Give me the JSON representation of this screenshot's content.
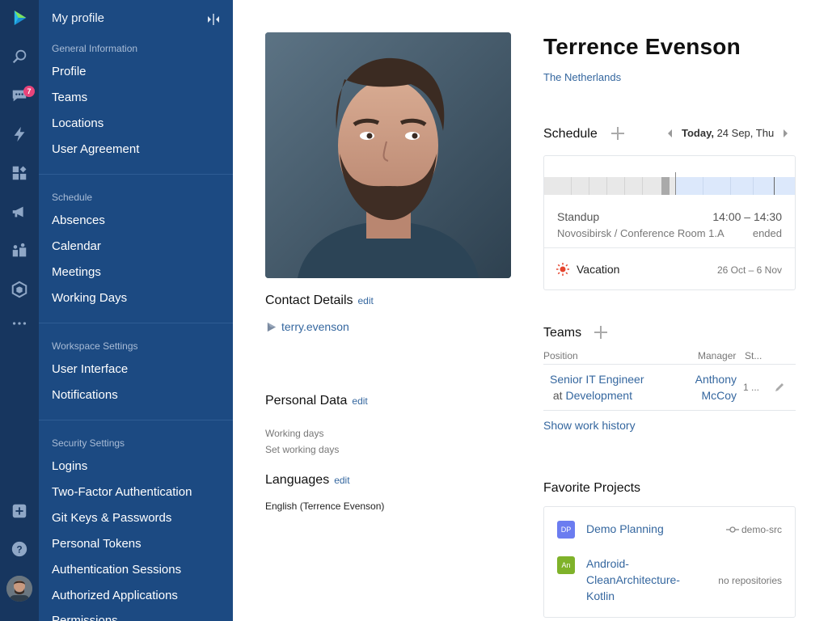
{
  "rail": {
    "icons": [
      "app-logo-icon",
      "search-icon",
      "chat-icon",
      "lightning-icon",
      "dashboard-icon",
      "megaphone-icon",
      "team-icon",
      "package-icon",
      "more-icon",
      "add-icon",
      "help-icon"
    ],
    "chat_badge": "7"
  },
  "sidebar": {
    "title": "My profile",
    "sections": [
      {
        "label": "General Information",
        "items": [
          "Profile",
          "Teams",
          "Locations",
          "User Agreement"
        ]
      },
      {
        "label": "Schedule",
        "items": [
          "Absences",
          "Calendar",
          "Meetings",
          "Working Days"
        ]
      },
      {
        "label": "Workspace Settings",
        "items": [
          "User Interface",
          "Notifications"
        ]
      },
      {
        "label": "Security Settings",
        "items": [
          "Logins",
          "Two-Factor Authentication",
          "Git Keys & Passwords",
          "Personal Tokens",
          "Authentication Sessions",
          "Authorized Applications",
          "Permissions"
        ]
      }
    ]
  },
  "profile": {
    "name": "Terrence Evenson",
    "country": "The Netherlands"
  },
  "contact": {
    "heading": "Contact Details",
    "edit": "edit",
    "username": "terry.evenson"
  },
  "personal": {
    "heading": "Personal Data",
    "edit": "edit",
    "working_days_label": "Working days",
    "working_days_link": "Set working days"
  },
  "languages": {
    "heading": "Languages",
    "edit": "edit",
    "value": "English (Terrence Evenson)"
  },
  "schedule": {
    "heading": "Schedule",
    "date_bold": "Today,",
    "date_rest": " 24 Sep, Thu",
    "event": {
      "title": "Standup",
      "time": "14:00 – 14:30",
      "location": "Novosibirsk / Conference Room 1.A",
      "status": "ended"
    },
    "vacation": {
      "label": "Vacation",
      "dates": "26 Oct – 6 Nov"
    }
  },
  "teams": {
    "heading": "Teams",
    "columns": {
      "position": "Position",
      "manager": "Manager",
      "status": "St..."
    },
    "row": {
      "role": "Senior IT Engineer",
      "at": " at ",
      "team": "Development",
      "manager": "Anthony McCoy",
      "status": "1 ..."
    },
    "history_link": "Show work history"
  },
  "projects": {
    "heading": "Favorite Projects",
    "items": [
      {
        "initials": "DP",
        "name": "Demo Planning",
        "repo": "demo-src",
        "color": "#6b7cf0"
      },
      {
        "initials": "An",
        "name": "Android-CleanArchitecture-Kotlin",
        "repo": "no repositories",
        "color": "#7fb22a"
      }
    ]
  }
}
